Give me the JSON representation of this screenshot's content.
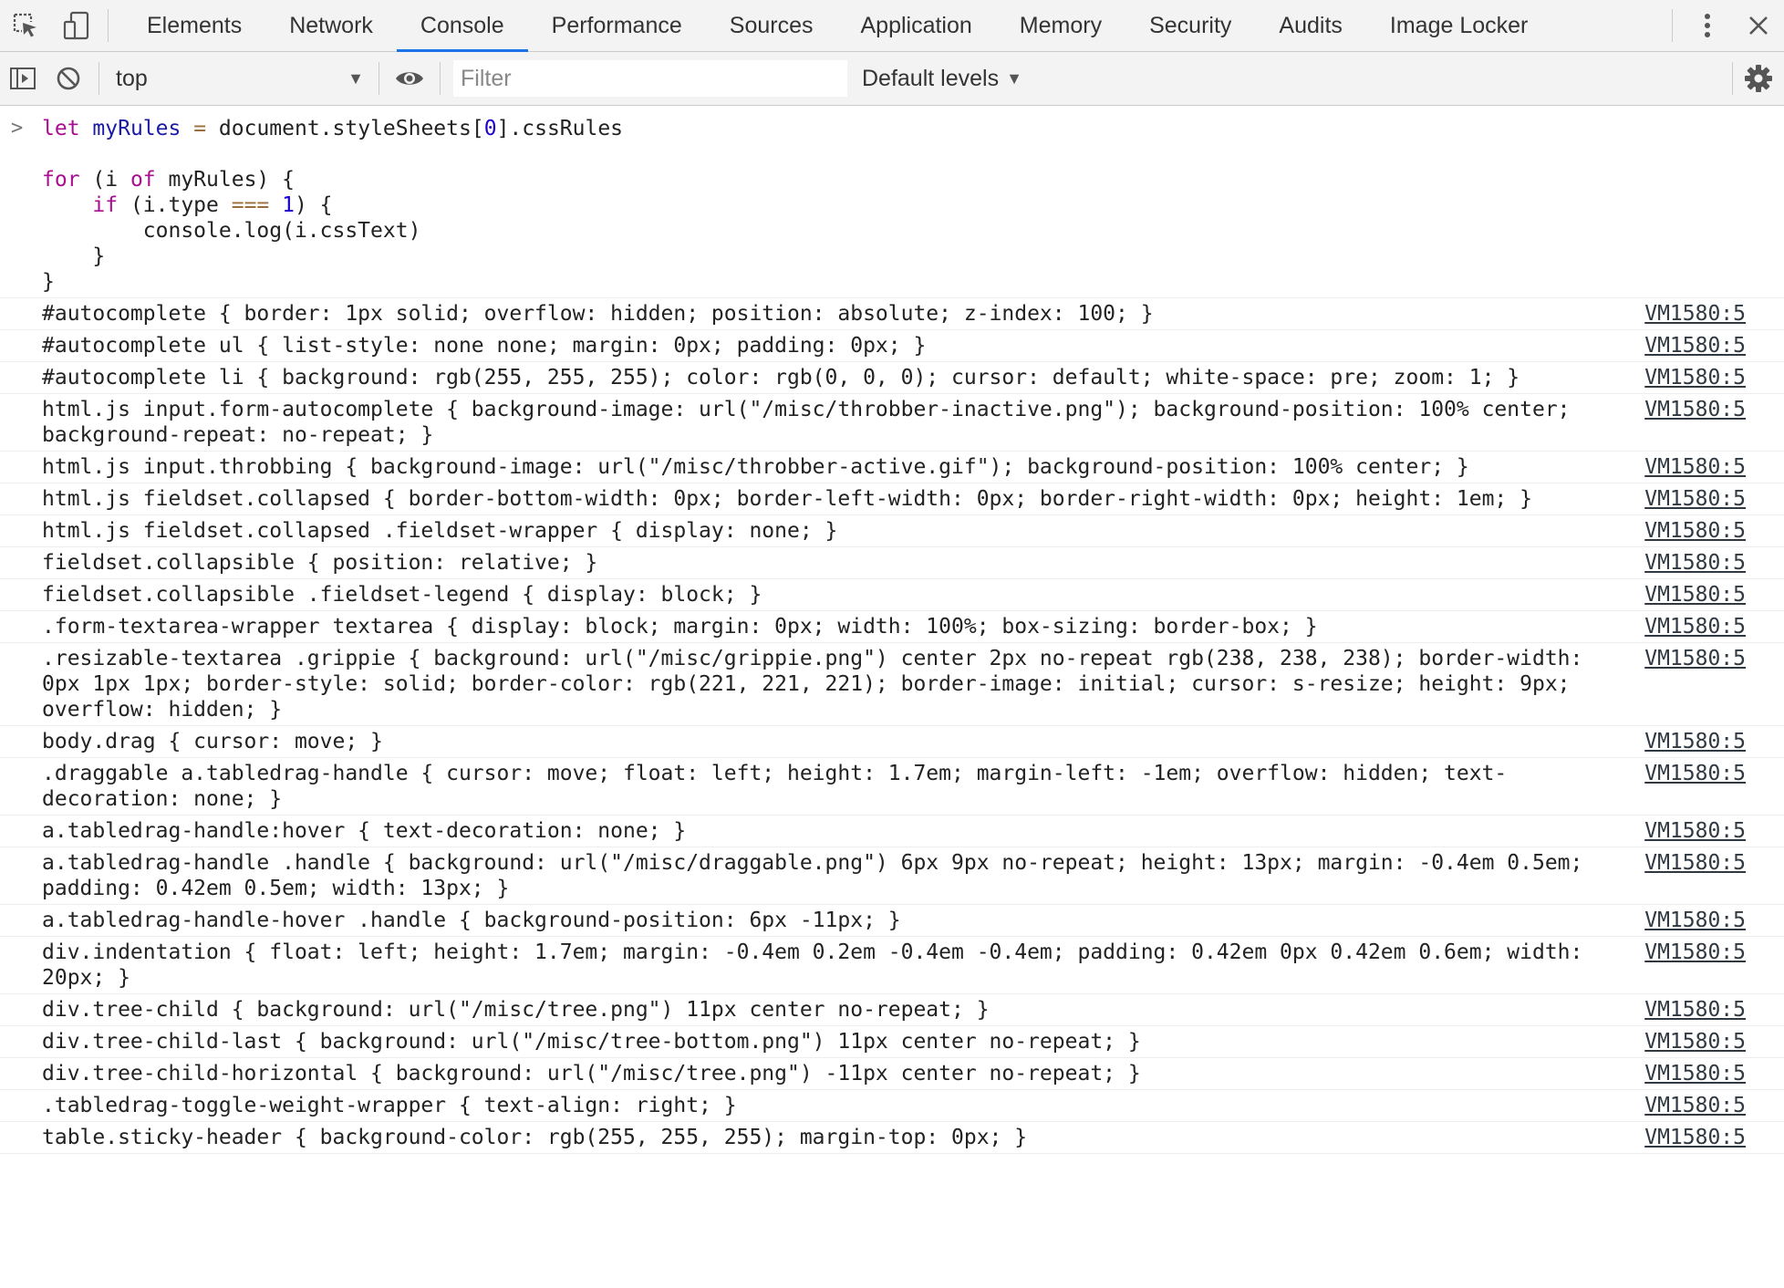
{
  "tabs": [
    {
      "label": "Elements",
      "active": false
    },
    {
      "label": "Network",
      "active": false
    },
    {
      "label": "Console",
      "active": true
    },
    {
      "label": "Performance",
      "active": false
    },
    {
      "label": "Sources",
      "active": false
    },
    {
      "label": "Application",
      "active": false
    },
    {
      "label": "Memory",
      "active": false
    },
    {
      "label": "Security",
      "active": false
    },
    {
      "label": "Audits",
      "active": false
    },
    {
      "label": "Image Locker",
      "active": false
    }
  ],
  "toolbar": {
    "context": "top",
    "filter_placeholder": "Filter",
    "filter_value": "",
    "levels_label": "Default levels"
  },
  "input": {
    "lines": [
      [
        {
          "t": "let",
          "c": "kw"
        },
        {
          "t": " "
        },
        {
          "t": "myRules",
          "c": "var"
        },
        {
          "t": " "
        },
        {
          "t": "=",
          "c": "op"
        },
        {
          "t": " document.styleSheets["
        },
        {
          "t": "0",
          "c": "num"
        },
        {
          "t": "].cssRules"
        }
      ],
      [
        {
          "t": ""
        }
      ],
      [
        {
          "t": "for",
          "c": "kw"
        },
        {
          "t": " (i "
        },
        {
          "t": "of",
          "c": "kw"
        },
        {
          "t": " myRules) {"
        }
      ],
      [
        {
          "t": "    "
        },
        {
          "t": "if",
          "c": "kw"
        },
        {
          "t": " (i.type "
        },
        {
          "t": "===",
          "c": "op"
        },
        {
          "t": " "
        },
        {
          "t": "1",
          "c": "num"
        },
        {
          "t": ") {"
        }
      ],
      [
        {
          "t": "        console.log(i.cssText)"
        }
      ],
      [
        {
          "t": "    }"
        }
      ],
      [
        {
          "t": "}"
        }
      ]
    ]
  },
  "messages": [
    {
      "text": "#autocomplete { border: 1px solid; overflow: hidden; position: absolute; z-index: 100; }",
      "source": "VM1580:5"
    },
    {
      "text": "#autocomplete ul { list-style: none none; margin: 0px; padding: 0px; }",
      "source": "VM1580:5"
    },
    {
      "text": "#autocomplete li { background: rgb(255, 255, 255); color: rgb(0, 0, 0); cursor: default; white-space: pre; zoom: 1; }",
      "source": "VM1580:5"
    },
    {
      "text": "html.js input.form-autocomplete { background-image: url(\"/misc/throbber-inactive.png\"); background-position: 100% center; background-repeat: no-repeat; }",
      "source": "VM1580:5",
      "wrap": true
    },
    {
      "text": "html.js input.throbbing { background-image: url(\"/misc/throbber-active.gif\"); background-position: 100% center; }",
      "source": "VM1580:5"
    },
    {
      "text": "html.js fieldset.collapsed { border-bottom-width: 0px; border-left-width: 0px; border-right-width: 0px; height: 1em; }",
      "source": "VM1580:5"
    },
    {
      "text": "html.js fieldset.collapsed .fieldset-wrapper { display: none; }",
      "source": "VM1580:5"
    },
    {
      "text": "fieldset.collapsible { position: relative; }",
      "source": "VM1580:5"
    },
    {
      "text": "fieldset.collapsible .fieldset-legend { display: block; }",
      "source": "VM1580:5"
    },
    {
      "text": ".form-textarea-wrapper textarea { display: block; margin: 0px; width: 100%; box-sizing: border-box; }",
      "source": "VM1580:5"
    },
    {
      "text": ".resizable-textarea .grippie { background: url(\"/misc/grippie.png\") center 2px no-repeat rgb(238, 238, 238); border-width: 0px 1px 1px; border-style: solid; border-color: rgb(221, 221, 221); border-image: initial; cursor: s-resize; height: 9px; overflow: hidden; }",
      "source": "VM1580:5",
      "wrap": true
    },
    {
      "text": "body.drag { cursor: move; }",
      "source": "VM1580:5"
    },
    {
      "text": ".draggable a.tabledrag-handle { cursor: move; float: left; height: 1.7em; margin-left: -1em; overflow: hidden; text-decoration: none; }",
      "source": "VM1580:5",
      "wrap": true
    },
    {
      "text": "a.tabledrag-handle:hover { text-decoration: none; }",
      "source": "VM1580:5"
    },
    {
      "text": "a.tabledrag-handle .handle { background: url(\"/misc/draggable.png\") 6px 9px no-repeat; height: 13px; margin: -0.4em 0.5em; padding: 0.42em 0.5em; width: 13px; }",
      "source": "VM1580:5",
      "wrap": true
    },
    {
      "text": "a.tabledrag-handle-hover .handle { background-position: 6px -11px; }",
      "source": "VM1580:5"
    },
    {
      "text": "div.indentation { float: left; height: 1.7em; margin: -0.4em 0.2em -0.4em -0.4em; padding: 0.42em 0px 0.42em 0.6em; width: 20px; }",
      "source": "VM1580:5",
      "wrap": true
    },
    {
      "text": "div.tree-child { background: url(\"/misc/tree.png\") 11px center no-repeat; }",
      "source": "VM1580:5"
    },
    {
      "text": "div.tree-child-last { background: url(\"/misc/tree-bottom.png\") 11px center no-repeat; }",
      "source": "VM1580:5"
    },
    {
      "text": "div.tree-child-horizontal { background: url(\"/misc/tree.png\") -11px center no-repeat; }",
      "source": "VM1580:5"
    },
    {
      "text": ".tabledrag-toggle-weight-wrapper { text-align: right; }",
      "source": "VM1580:5"
    },
    {
      "text": "table.sticky-header { background-color: rgb(255, 255, 255); margin-top: 0px; }",
      "source": "VM1580:5"
    }
  ],
  "icons": {
    "inspect": "inspect-element-icon",
    "device": "device-toolbar-icon",
    "more": "more-vertical-icon",
    "close": "close-icon",
    "sidebar": "sidebar-toggle-icon",
    "clear": "clear-console-icon",
    "eye": "eye-icon",
    "settings": "gear-icon"
  },
  "colors": {
    "accent": "#1a73e8",
    "keyword": "#aa0d91",
    "variable": "#1a1aa6",
    "operator": "#9a6e3a",
    "number": "#1c00cf"
  }
}
